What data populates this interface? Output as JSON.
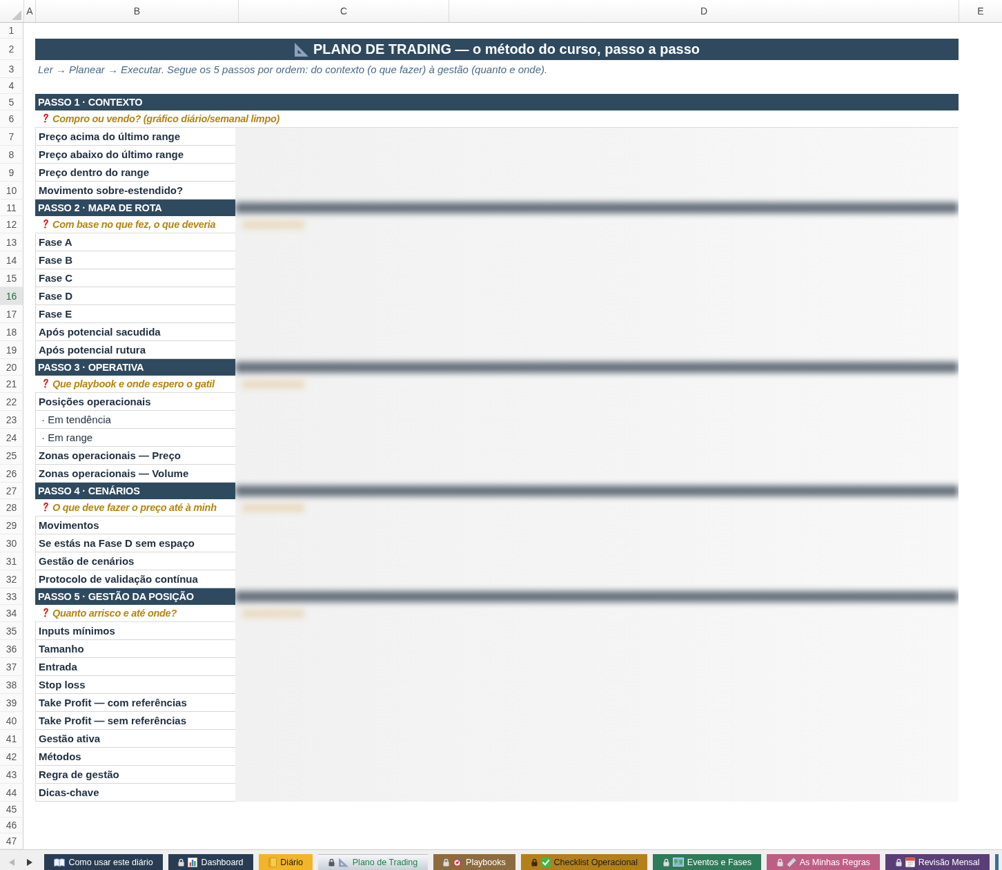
{
  "column_headers": [
    "A",
    "B",
    "C",
    "D",
    "E"
  ],
  "row_headers": [
    {
      "label": "1",
      "selected": false
    },
    {
      "label": "2",
      "selected": false
    },
    {
      "label": "3",
      "selected": false
    },
    {
      "label": "4",
      "selected": false
    },
    {
      "label": "5",
      "selected": false
    },
    {
      "label": "6",
      "selected": false
    },
    {
      "label": "7",
      "selected": false
    },
    {
      "label": "8",
      "selected": false
    },
    {
      "label": "9",
      "selected": false
    },
    {
      "label": "10",
      "selected": false
    },
    {
      "label": "11",
      "selected": false
    },
    {
      "label": "12",
      "selected": false
    },
    {
      "label": "13",
      "selected": false
    },
    {
      "label": "14",
      "selected": false
    },
    {
      "label": "15",
      "selected": false
    },
    {
      "label": "16",
      "selected": true
    },
    {
      "label": "17",
      "selected": false
    },
    {
      "label": "18",
      "selected": false
    },
    {
      "label": "19",
      "selected": false
    },
    {
      "label": "20",
      "selected": false
    },
    {
      "label": "21",
      "selected": false
    },
    {
      "label": "22",
      "selected": false
    },
    {
      "label": "23",
      "selected": false
    },
    {
      "label": "24",
      "selected": false
    },
    {
      "label": "25",
      "selected": false
    },
    {
      "label": "26",
      "selected": false
    },
    {
      "label": "27",
      "selected": false
    },
    {
      "label": "28",
      "selected": false
    },
    {
      "label": "29",
      "selected": false
    },
    {
      "label": "30",
      "selected": false
    },
    {
      "label": "31",
      "selected": false
    },
    {
      "label": "32",
      "selected": false
    },
    {
      "label": "33",
      "selected": false
    },
    {
      "label": "34",
      "selected": false
    },
    {
      "label": "35",
      "selected": false
    },
    {
      "label": "36",
      "selected": false
    },
    {
      "label": "37",
      "selected": false
    },
    {
      "label": "38",
      "selected": false
    },
    {
      "label": "39",
      "selected": false
    },
    {
      "label": "40",
      "selected": false
    },
    {
      "label": "41",
      "selected": false
    },
    {
      "label": "42",
      "selected": false
    },
    {
      "label": "43",
      "selected": false
    },
    {
      "label": "44",
      "selected": false
    },
    {
      "label": "45",
      "selected": false
    },
    {
      "label": "46",
      "selected": false
    },
    {
      "label": "47",
      "selected": false
    }
  ],
  "title": "PLANO DE TRADING — o método do curso, passo a passo",
  "subtitle": "Ler → Planear → Executar. Segue os 5 passos por ordem: do contexto (o que fazer) à gestão (quanto e onde).",
  "sections": [
    {
      "heading": "PASSO 1 · CONTEXTO",
      "question": "Compro ou vendo? (gráfico diário/semanal limpo)",
      "items": [
        {
          "label": "Preço acima do último range",
          "kind": "main"
        },
        {
          "label": "Preço abaixo do último range",
          "kind": "main"
        },
        {
          "label": "Preço dentro do range",
          "kind": "main"
        },
        {
          "label": "Movimento sobre-estendido?",
          "kind": "main"
        }
      ]
    },
    {
      "heading": "PASSO 2 · MAPA DE ROTA",
      "question": "Com base no que fez, o que deveria",
      "items": [
        {
          "label": "Fase A",
          "kind": "main"
        },
        {
          "label": "Fase B",
          "kind": "main"
        },
        {
          "label": "Fase C",
          "kind": "main"
        },
        {
          "label": "Fase D",
          "kind": "main"
        },
        {
          "label": "Fase E",
          "kind": "main"
        },
        {
          "label": "Após potencial sacudida",
          "kind": "main"
        },
        {
          "label": "Após potencial rutura",
          "kind": "main"
        }
      ]
    },
    {
      "heading": "PASSO 3 · OPERATIVA",
      "question": "Que playbook e onde espero o gatil",
      "items": [
        {
          "label": "Posições operacionais",
          "kind": "main"
        },
        {
          "label": "· Em tendência",
          "kind": "sub"
        },
        {
          "label": "· Em range",
          "kind": "sub"
        },
        {
          "label": "Zonas operacionais — Preço",
          "kind": "main"
        },
        {
          "label": "Zonas operacionais — Volume",
          "kind": "main"
        }
      ]
    },
    {
      "heading": "PASSO 4 · CENÁRIOS",
      "question": "O que deve fazer o preço até à minh",
      "items": [
        {
          "label": "Movimentos",
          "kind": "main"
        },
        {
          "label": "Se estás na Fase D sem espaço",
          "kind": "main"
        },
        {
          "label": "Gestão de cenários",
          "kind": "main"
        },
        {
          "label": "Protocolo de validação contínua",
          "kind": "main"
        }
      ]
    },
    {
      "heading": "PASSO 5 · GESTÃO DA POSIÇÃO",
      "question": "Quanto arrisco e até onde?",
      "items": [
        {
          "label": "Inputs mínimos",
          "kind": "main"
        },
        {
          "label": "Tamanho",
          "kind": "main"
        },
        {
          "label": "Entrada",
          "kind": "main"
        },
        {
          "label": "Stop loss",
          "kind": "main"
        },
        {
          "label": "Take Profit — com referências",
          "kind": "main"
        },
        {
          "label": "Take Profit — sem referências",
          "kind": "main"
        },
        {
          "label": "Gestão ativa",
          "kind": "main"
        },
        {
          "label": "Métodos",
          "kind": "main"
        },
        {
          "label": "Regra de gestão",
          "kind": "main"
        },
        {
          "label": "Dicas-chave",
          "kind": "main"
        }
      ]
    }
  ],
  "tab_navigation": {
    "back_enabled": false,
    "forward_enabled": true
  },
  "sheet_tabs": [
    {
      "label": "Como usar este diário",
      "color": "#293c52",
      "locked": false,
      "selected": false
    },
    {
      "label": "Dashboard",
      "color": "#293c52",
      "locked": true,
      "selected": false
    },
    {
      "label": "Diário",
      "color": "#f2b428",
      "locked": false,
      "selected": false
    },
    {
      "label": "Plano de Trading",
      "color": "#c9d0d8",
      "locked": true,
      "selected": true
    },
    {
      "label": "Playbooks",
      "color": "#8c6c3e",
      "locked": true,
      "selected": false
    },
    {
      "label": "Checklist Operacional",
      "color": "#b3801a",
      "locked": true,
      "selected": false
    },
    {
      "label": "Eventos e Fases",
      "color": "#2e7b59",
      "locked": true,
      "selected": false
    },
    {
      "label": "As Minhas Regras",
      "color": "#bf5e85",
      "locked": true,
      "selected": false
    },
    {
      "label": "Revisão Mensal",
      "color": "#5a3e76",
      "locked": true,
      "selected": false
    },
    {
      "color": "#3b6d98",
      "locked": false,
      "selected": false
    }
  ]
}
